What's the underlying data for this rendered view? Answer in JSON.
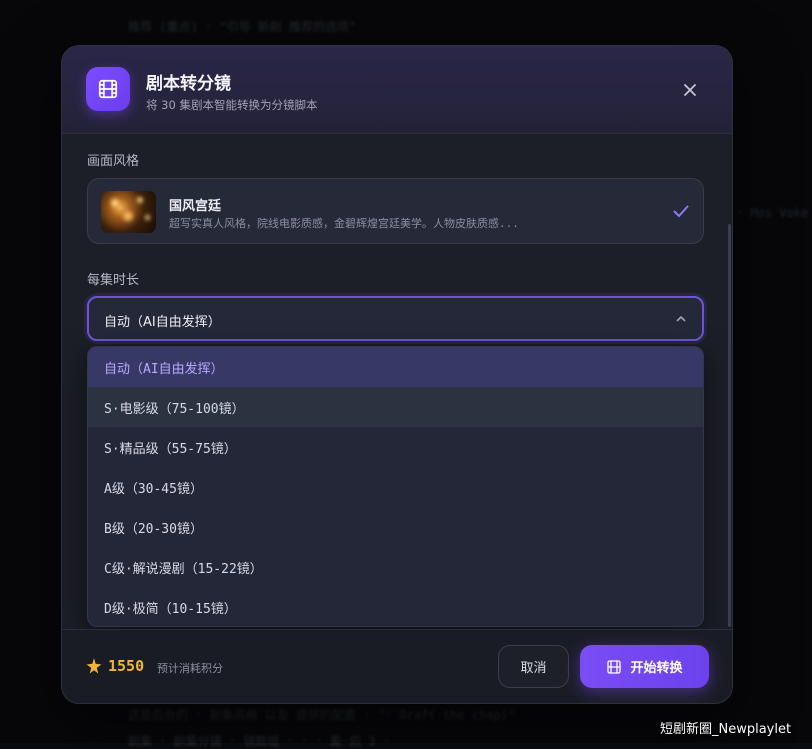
{
  "background": {
    "top_text": "推荐 (重点) · \"引导 新剧 推荐的选项\"",
    "right_text": "· Mos Voke",
    "bottom_text_1": "这是后台的 · 剧集风格 以及 提供的配置 · \"· Oraft  the chap)\"",
    "bottom_text_2": "剧集 · 剧集分镜 · 镜数组 · · · 集·后 3 ·"
  },
  "modal": {
    "title": "剧本转分镜",
    "subtitle": "将 30 集剧本智能转换为分镜脚本",
    "header_icon": "film-icon",
    "close_icon": "close-icon"
  },
  "style_section": {
    "label": "画面风格",
    "selected": {
      "name": "国风宫廷",
      "description": "超写实真人风格，院线电影质感，金碧辉煌宫廷美学。人物皮肤质感...",
      "check_icon": "check-icon"
    }
  },
  "duration_section": {
    "label": "每集时长",
    "current_value": "自动（AI自由发挥）",
    "options": [
      {
        "label": "自动（AI自由发挥）",
        "state": "selected"
      },
      {
        "label": "S·电影级（75-100镜）",
        "state": "hover"
      },
      {
        "label": "S·精品级（55-75镜）",
        "state": ""
      },
      {
        "label": "A级（30-45镜）",
        "state": ""
      },
      {
        "label": "B级（20-30镜）",
        "state": ""
      },
      {
        "label": "C级·解说漫剧（15-22镜）",
        "state": ""
      },
      {
        "label": "D级·极简（10-15镜）",
        "state": ""
      }
    ]
  },
  "footer": {
    "credits_icon": "sparkle-icon",
    "credits_value": "1550",
    "credits_label": "预计消耗积分",
    "cancel_label": "取消",
    "start_label": "开始转换",
    "start_icon": "film-icon"
  },
  "colors": {
    "accent": "#7a4cf5",
    "credits": "#f0b43c",
    "selected_text": "#b7a9ff"
  },
  "watermark": "短剧新圈_Newplaylet"
}
